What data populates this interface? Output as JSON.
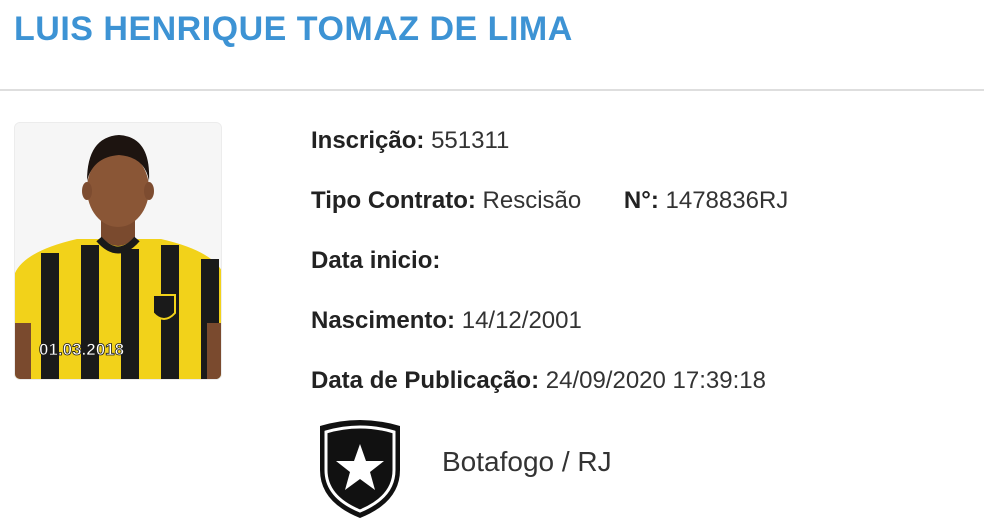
{
  "player": {
    "name": "LUIS HENRIQUE TOMAZ DE LIMA",
    "photo_caption": "01.03.2018"
  },
  "fields": {
    "inscricao_label": "Inscrição:",
    "inscricao_value": "551311",
    "tipo_contrato_label": "Tipo Contrato:",
    "tipo_contrato_value": "Rescisão",
    "numero_label": "N°:",
    "numero_value": "1478836RJ",
    "data_inicio_label": "Data inicio:",
    "data_inicio_value": "",
    "nascimento_label": "Nascimento:",
    "nascimento_value": "14/12/2001",
    "data_publicacao_label": "Data de Publicação:",
    "data_publicacao_value": "24/09/2020 17:39:18"
  },
  "club": {
    "name": "Botafogo / RJ",
    "logo_icon": "botafogo-star-shield-icon"
  },
  "colors": {
    "title": "#3d93d4",
    "jersey_yellow": "#f2d21a",
    "jersey_black": "#1a1a1a"
  }
}
